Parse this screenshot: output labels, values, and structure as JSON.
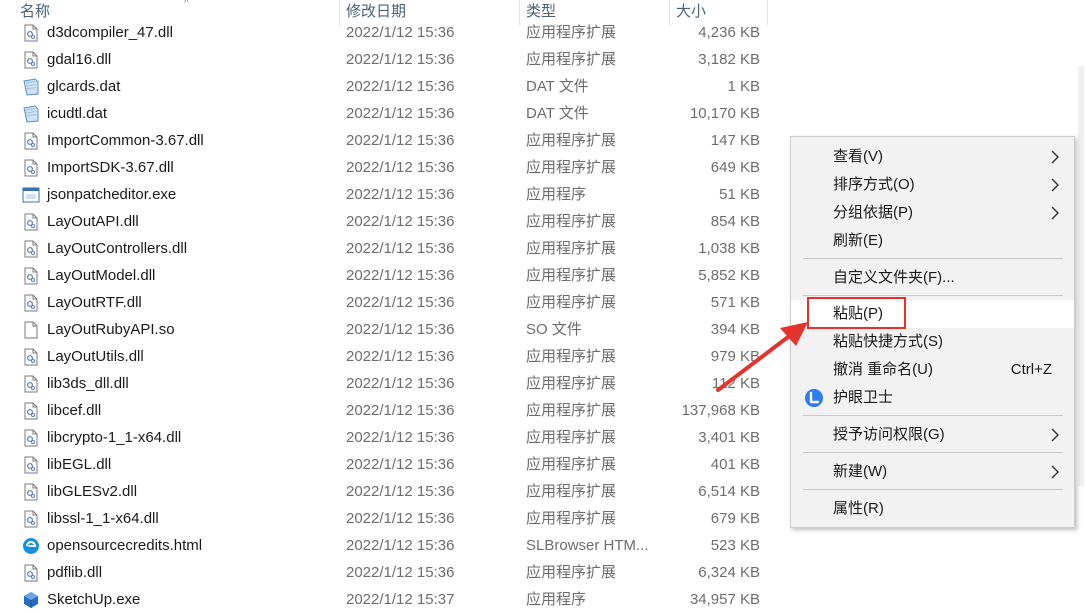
{
  "columns": {
    "name": "名称",
    "date": "修改日期",
    "type": "类型",
    "size": "大小"
  },
  "files": [
    {
      "name": "d3dcompiler_47.dll",
      "date": "2022/1/12 15:36",
      "type": "应用程序扩展",
      "size": "4,236 KB",
      "icon": "dll"
    },
    {
      "name": "gdal16.dll",
      "date": "2022/1/12 15:36",
      "type": "应用程序扩展",
      "size": "3,182 KB",
      "icon": "dll"
    },
    {
      "name": "glcards.dat",
      "date": "2022/1/12 15:36",
      "type": "DAT 文件",
      "size": "1 KB",
      "icon": "dat"
    },
    {
      "name": "icudtl.dat",
      "date": "2022/1/12 15:36",
      "type": "DAT 文件",
      "size": "10,170 KB",
      "icon": "dat"
    },
    {
      "name": "ImportCommon-3.67.dll",
      "date": "2022/1/12 15:36",
      "type": "应用程序扩展",
      "size": "147 KB",
      "icon": "dll"
    },
    {
      "name": "ImportSDK-3.67.dll",
      "date": "2022/1/12 15:36",
      "type": "应用程序扩展",
      "size": "649 KB",
      "icon": "dll"
    },
    {
      "name": "jsonpatcheditor.exe",
      "date": "2022/1/12 15:36",
      "type": "应用程序",
      "size": "51 KB",
      "icon": "exe"
    },
    {
      "name": "LayOutAPI.dll",
      "date": "2022/1/12 15:36",
      "type": "应用程序扩展",
      "size": "854 KB",
      "icon": "dll"
    },
    {
      "name": "LayOutControllers.dll",
      "date": "2022/1/12 15:36",
      "type": "应用程序扩展",
      "size": "1,038 KB",
      "icon": "dll"
    },
    {
      "name": "LayOutModel.dll",
      "date": "2022/1/12 15:36",
      "type": "应用程序扩展",
      "size": "5,852 KB",
      "icon": "dll"
    },
    {
      "name": "LayOutRTF.dll",
      "date": "2022/1/12 15:36",
      "type": "应用程序扩展",
      "size": "571 KB",
      "icon": "dll"
    },
    {
      "name": "LayOutRubyAPI.so",
      "date": "2022/1/12 15:36",
      "type": "SO 文件",
      "size": "394 KB",
      "icon": "file"
    },
    {
      "name": "LayOutUtils.dll",
      "date": "2022/1/12 15:36",
      "type": "应用程序扩展",
      "size": "979 KB",
      "icon": "dll"
    },
    {
      "name": "lib3ds_dll.dll",
      "date": "2022/1/12 15:36",
      "type": "应用程序扩展",
      "size": "112 KB",
      "icon": "dll"
    },
    {
      "name": "libcef.dll",
      "date": "2022/1/12 15:36",
      "type": "应用程序扩展",
      "size": "137,968 KB",
      "icon": "dll"
    },
    {
      "name": "libcrypto-1_1-x64.dll",
      "date": "2022/1/12 15:36",
      "type": "应用程序扩展",
      "size": "3,401 KB",
      "icon": "dll"
    },
    {
      "name": "libEGL.dll",
      "date": "2022/1/12 15:36",
      "type": "应用程序扩展",
      "size": "401 KB",
      "icon": "dll"
    },
    {
      "name": "libGLESv2.dll",
      "date": "2022/1/12 15:36",
      "type": "应用程序扩展",
      "size": "6,514 KB",
      "icon": "dll"
    },
    {
      "name": "libssl-1_1-x64.dll",
      "date": "2022/1/12 15:36",
      "type": "应用程序扩展",
      "size": "679 KB",
      "icon": "dll"
    },
    {
      "name": "opensourcecredits.html",
      "date": "2022/1/12 15:36",
      "type": "SLBrowser HTM...",
      "size": "523 KB",
      "icon": "html"
    },
    {
      "name": "pdflib.dll",
      "date": "2022/1/12 15:36",
      "type": "应用程序扩展",
      "size": "6,324 KB",
      "icon": "dll"
    },
    {
      "name": "SketchUp.exe",
      "date": "2022/1/12 15:37",
      "type": "应用程序",
      "size": "34,957 KB",
      "icon": "sketchup"
    }
  ],
  "context_menu": {
    "view": "查看(V)",
    "sort": "排序方式(O)",
    "group": "分组依据(P)",
    "refresh": "刷新(E)",
    "customize": "自定义文件夹(F)...",
    "paste": "粘贴(P)",
    "paste_shortcut": "粘贴快捷方式(S)",
    "undo": "撤消 重命名(U)",
    "undo_shortcut": "Ctrl+Z",
    "eye_guard": "护眼卫士",
    "grant_access": "授予访问权限(G)",
    "new": "新建(W)",
    "properties": "属性(R)"
  },
  "colors": {
    "annotation_red": "#e5322d",
    "header_text": "#4c607a",
    "menu_bg": "#f2f2f2",
    "eye_icon": "#2e7bf6"
  }
}
